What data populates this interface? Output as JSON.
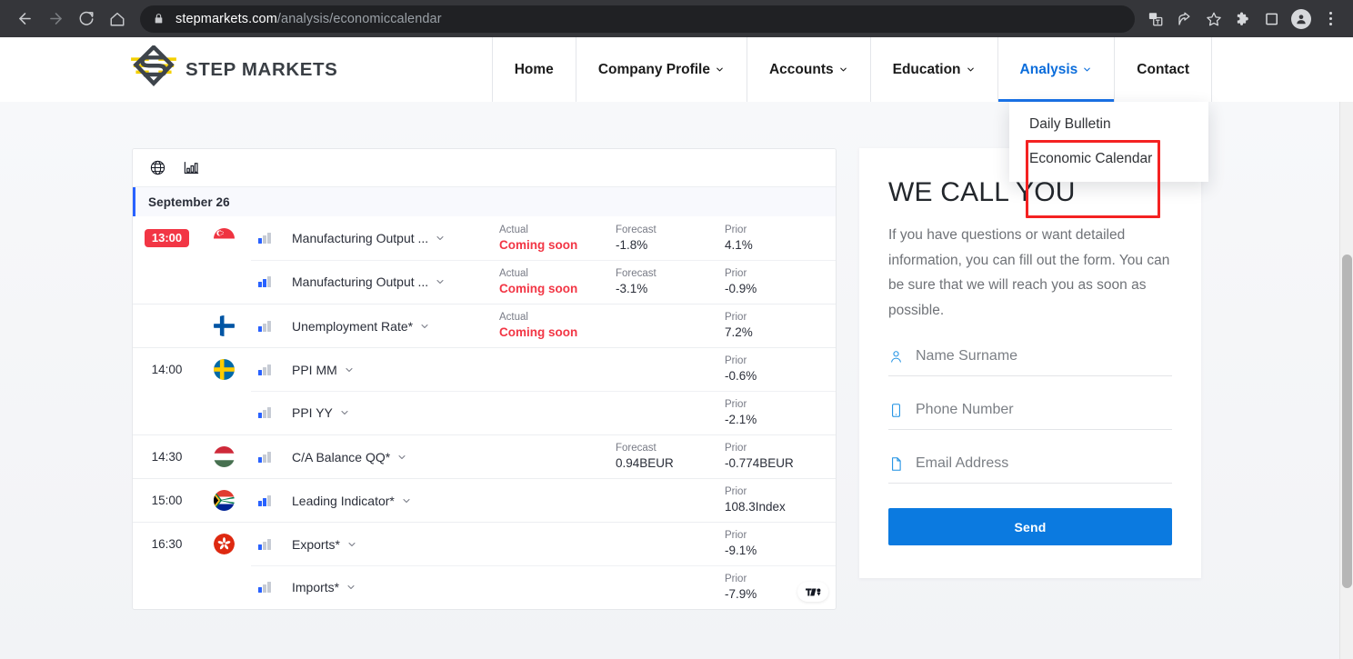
{
  "browser": {
    "back_label": "Back",
    "forward_label": "Forward",
    "reload_label": "Reload",
    "home_label": "Home",
    "url_host": "stepmarkets.com",
    "url_path": "/analysis/economiccalendar",
    "lock_icon": "lock-icon",
    "toolbar_icons": [
      "translate-icon",
      "share-icon",
      "bookmark-star-icon",
      "extensions-puzzle-icon",
      "side-panel-icon",
      "profile-avatar-icon",
      "chrome-menu-icon"
    ]
  },
  "site": {
    "brand": "STEP MARKETS",
    "nav": [
      {
        "label": "Home",
        "has_caret": false,
        "active": false
      },
      {
        "label": "Company Profile",
        "has_caret": true,
        "active": false
      },
      {
        "label": "Accounts",
        "has_caret": true,
        "active": false
      },
      {
        "label": "Education",
        "has_caret": true,
        "active": false
      },
      {
        "label": "Analysis",
        "has_caret": true,
        "active": true
      },
      {
        "label": "Contact",
        "has_caret": false,
        "active": false
      }
    ],
    "dropdown": {
      "parent": "Analysis",
      "items": [
        "Daily Bulletin",
        "Economic Calendar"
      ],
      "highlight_color": "#f42222"
    }
  },
  "calendar": {
    "toolbar_icons": [
      "globe-icon",
      "bar-chart-icon"
    ],
    "date_header": "September 26",
    "columns": {
      "actual": "Actual",
      "forecast": "Forecast",
      "prior": "Prior"
    },
    "coming_soon": "Coming soon",
    "accent_color": "#2962ff",
    "alert_color": "#f23645",
    "attribution": "tradingview-logo",
    "rows": [
      {
        "time": "13:00",
        "time_badge": true,
        "flag": "singapore",
        "flag_show": true,
        "volatility": 1,
        "event": "Manufacturing Output ...",
        "actual": "Coming soon",
        "actual_is_soon": true,
        "forecast": "-1.8%",
        "prior": "4.1%",
        "separator": "full"
      },
      {
        "time": "",
        "time_badge": false,
        "flag": "singapore",
        "flag_show": false,
        "volatility": 2,
        "event": "Manufacturing Output ...",
        "actual": "Coming soon",
        "actual_is_soon": true,
        "forecast": "-3.1%",
        "prior": "-0.9%",
        "separator": "indent"
      },
      {
        "time": "",
        "time_badge": false,
        "flag": "finland",
        "flag_show": true,
        "volatility": 1,
        "event": "Unemployment Rate*",
        "actual": "Coming soon",
        "actual_is_soon": true,
        "forecast": "",
        "prior": "7.2%",
        "separator": "full"
      },
      {
        "time": "14:00",
        "time_badge": false,
        "flag": "sweden",
        "flag_show": true,
        "volatility": 1,
        "event": "PPI MM",
        "actual": "",
        "actual_is_soon": false,
        "forecast": "",
        "prior": "-0.6%",
        "separator": "full"
      },
      {
        "time": "",
        "time_badge": false,
        "flag": "sweden",
        "flag_show": false,
        "volatility": 1,
        "event": "PPI YY",
        "actual": "",
        "actual_is_soon": false,
        "forecast": "",
        "prior": "-2.1%",
        "separator": "indent"
      },
      {
        "time": "14:30",
        "time_badge": false,
        "flag": "hungary",
        "flag_show": true,
        "volatility": 1,
        "event": "C/A Balance QQ*",
        "actual": "",
        "actual_is_soon": false,
        "forecast": "0.94BEUR",
        "prior": "-0.774BEUR",
        "separator": "full"
      },
      {
        "time": "15:00",
        "time_badge": false,
        "flag": "southafrica",
        "flag_show": true,
        "volatility": 2,
        "event": "Leading Indicator*",
        "actual": "",
        "actual_is_soon": false,
        "forecast": "",
        "prior": "108.3Index",
        "separator": "full"
      },
      {
        "time": "16:30",
        "time_badge": false,
        "flag": "hongkong",
        "flag_show": true,
        "volatility": 1,
        "event": "Exports*",
        "actual": "",
        "actual_is_soon": false,
        "forecast": "",
        "prior": "-9.1%",
        "separator": "full"
      },
      {
        "time": "",
        "time_badge": false,
        "flag": "hongkong",
        "flag_show": false,
        "volatility": 1,
        "event": "Imports*",
        "actual": "",
        "actual_is_soon": false,
        "forecast": "",
        "prior": "-7.9%",
        "separator": "indent"
      }
    ]
  },
  "call_form": {
    "title": "WE CALL YOU",
    "description": "If you have questions or want detailed information, you can fill out the form. You can be sure that we will reach you as soon as possible.",
    "fields": [
      {
        "icon": "user-icon",
        "placeholder": "Name Surname",
        "value": ""
      },
      {
        "icon": "phone-icon",
        "placeholder": "Phone Number",
        "value": ""
      },
      {
        "icon": "document-icon",
        "placeholder": "Email Address",
        "value": ""
      }
    ],
    "submit_label": "Send",
    "submit_color": "#0b7ae0"
  }
}
